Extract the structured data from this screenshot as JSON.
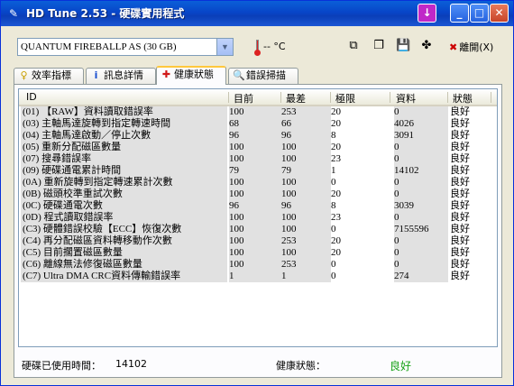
{
  "window": {
    "title": "HD Tune 2.53 - 硬碟實用程式"
  },
  "toolbar": {
    "drive": "QUANTUM FIREBALLP AS (30 GB)",
    "temperature": "-- °C",
    "exit_label": "離開(X)"
  },
  "tabs": [
    {
      "label": "效率指標",
      "icon": "benchmark-icon"
    },
    {
      "label": "訊息詳情",
      "icon": "info-icon"
    },
    {
      "label": "健康狀態",
      "icon": "health-icon",
      "active": true
    },
    {
      "label": "錯誤掃描",
      "icon": "error-scan-icon"
    }
  ],
  "table": {
    "columns": [
      "ID",
      "目前",
      "最差",
      "極限",
      "資料",
      "狀態"
    ],
    "rows": [
      [
        "(01) 【RAW】資料讀取錯誤率",
        "100",
        "253",
        "20",
        "0",
        "良好"
      ],
      [
        "(03) 主軸馬達旋轉到指定轉速時間",
        "68",
        "66",
        "20",
        "4026",
        "良好"
      ],
      [
        "(04) 主軸馬達啟動／停止次數",
        "96",
        "96",
        "8",
        "3091",
        "良好"
      ],
      [
        "(05) 重新分配磁區數量",
        "100",
        "100",
        "20",
        "0",
        "良好"
      ],
      [
        "(07) 搜尋錯誤率",
        "100",
        "100",
        "23",
        "0",
        "良好"
      ],
      [
        "(09) 硬碟通電累計時間",
        "79",
        "79",
        "1",
        "14102",
        "良好"
      ],
      [
        "(0A) 重新旋轉到指定轉速累計次數",
        "100",
        "100",
        "0",
        "0",
        "良好"
      ],
      [
        "(0B) 磁頭校準重試次數",
        "100",
        "100",
        "20",
        "0",
        "良好"
      ],
      [
        "(0C) 硬碟通電次數",
        "96",
        "96",
        "8",
        "3039",
        "良好"
      ],
      [
        "(0D) 程式讀取錯誤率",
        "100",
        "100",
        "23",
        "0",
        "良好"
      ],
      [
        "(C3) 硬體錯誤校驗【ECC】恢復次數",
        "100",
        "100",
        "0",
        "7155596",
        "良好"
      ],
      [
        "(C4) 再分配磁區資料轉移動作次數",
        "100",
        "253",
        "20",
        "0",
        "良好"
      ],
      [
        "(C5) 目前擱置磁區數量",
        "100",
        "100",
        "20",
        "0",
        "良好"
      ],
      [
        "(C6) 離線無法修復磁區數量",
        "100",
        "253",
        "0",
        "0",
        "良好"
      ],
      [
        "(C7) Ultra DMA CRC資料傳輸錯誤率",
        "1",
        "1",
        "0",
        "274",
        "良好"
      ]
    ]
  },
  "status": {
    "power_on_label": "硬碟已使用時間：",
    "power_on_value": "14102",
    "health_label": "健康狀態：",
    "health_value": "良好",
    "good_color": "#1aa31a"
  }
}
